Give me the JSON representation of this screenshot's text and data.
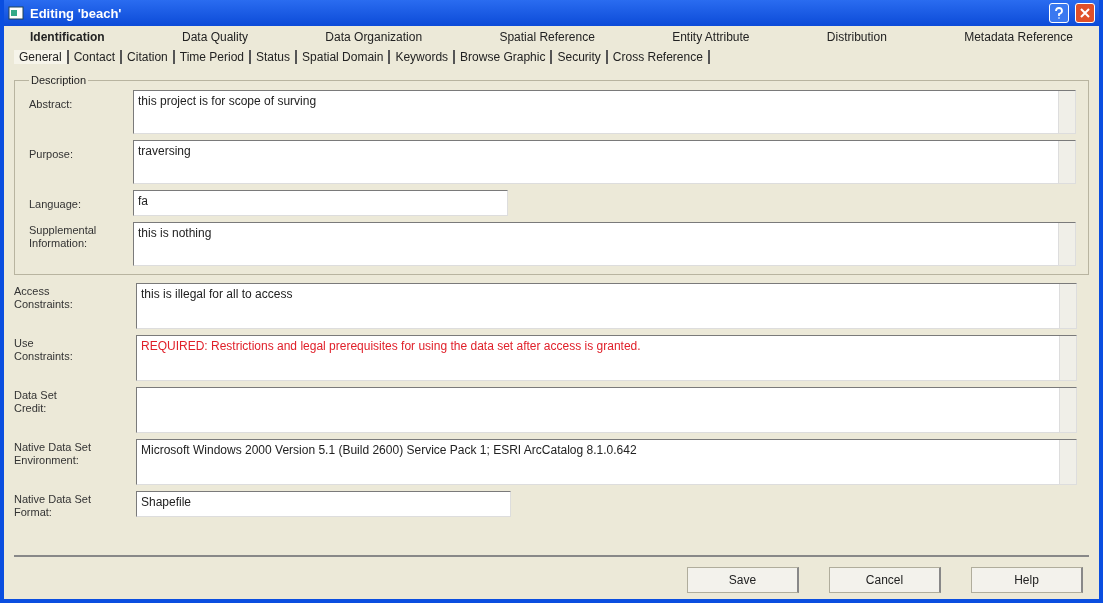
{
  "window": {
    "title": "Editing 'beach'"
  },
  "tabs": [
    {
      "label": "Identification",
      "selected": true
    },
    {
      "label": "Data Quality",
      "selected": false
    },
    {
      "label": "Data Organization",
      "selected": false
    },
    {
      "label": "Spatial Reference",
      "selected": false
    },
    {
      "label": "Entity Attribute",
      "selected": false
    },
    {
      "label": "Distribution",
      "selected": false
    },
    {
      "label": "Metadata Reference",
      "selected": false
    }
  ],
  "subtabs": [
    {
      "label": "General",
      "selected": true
    },
    {
      "label": "Contact",
      "selected": false
    },
    {
      "label": "Citation",
      "selected": false
    },
    {
      "label": "Time Period",
      "selected": false
    },
    {
      "label": "Status",
      "selected": false
    },
    {
      "label": "Spatial Domain",
      "selected": false
    },
    {
      "label": "Keywords",
      "selected": false
    },
    {
      "label": "Browse Graphic",
      "selected": false
    },
    {
      "label": "Security",
      "selected": false
    },
    {
      "label": "Cross Reference",
      "selected": false
    }
  ],
  "description": {
    "title": "Description",
    "fields": [
      {
        "label": "Abstract:",
        "value": "this project is for scope of surving",
        "kind": "memo",
        "required": false
      },
      {
        "label": "Purpose:",
        "value": "traversing",
        "kind": "memo",
        "required": false
      },
      {
        "label": "Language:",
        "value": "fa",
        "kind": "line",
        "required": false
      },
      {
        "label": "Supplemental Information:",
        "value": "this is nothing",
        "kind": "memo",
        "required": false
      }
    ]
  },
  "fields": [
    {
      "label": "Access Constraints:",
      "value": "this is illegal for all to access",
      "kind": "memo",
      "required": false
    },
    {
      "label": "Use Constraints:",
      "value": "REQUIRED: Restrictions and legal prerequisites for using the data set after access is granted.",
      "kind": "memo",
      "required": true
    },
    {
      "label": "Data Set Credit:",
      "kind": "memo"
    },
    {
      "label": "Native Data Set Environment:",
      "value": "Microsoft Windows 2000 Version 5.1 (Build 2600) Service Pack 1; ESRI ArcCatalog 8.1.0.642",
      "kind": "memo",
      "required": false
    },
    {
      "label": "Native Data Set Format:",
      "value": "Shapefile",
      "kind": "line",
      "required": false
    }
  ],
  "buttons": [
    "Save",
    "Cancel",
    "Help"
  ]
}
